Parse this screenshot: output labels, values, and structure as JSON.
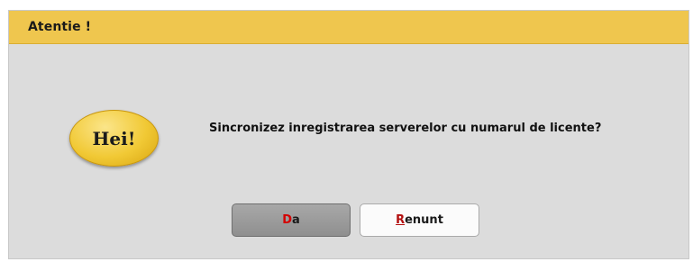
{
  "dialog": {
    "title": "Atentie !",
    "badge_text": "Hei!",
    "message": "Sincronizez inregistrarea serverelor cu numarul de licente?",
    "buttons": {
      "yes": {
        "accel": "D",
        "rest": "a"
      },
      "cancel": {
        "accel": "R",
        "rest": "enunt"
      }
    }
  },
  "colors": {
    "titlebar": "#efc64e",
    "dialog_bg": "#dcdcdc",
    "badge": "#f1c935",
    "accelerator": "#d40000"
  }
}
